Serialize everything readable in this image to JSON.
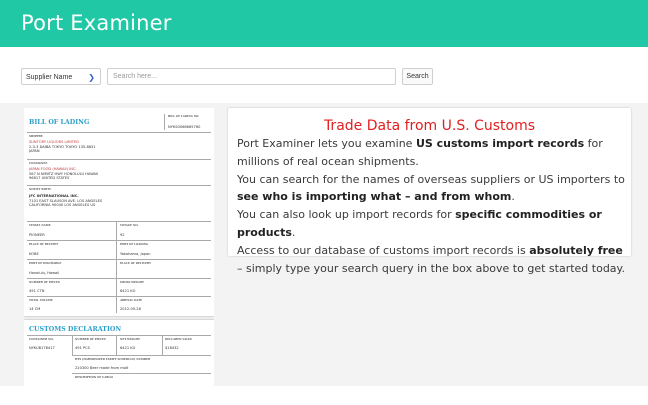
{
  "header": {
    "title": "Port Examiner"
  },
  "search": {
    "select_value": "Supplier Name",
    "placeholder": "Search here...",
    "button_label": "Search"
  },
  "document": {
    "bol_title": "BILL OF LADING",
    "bol_no_label": "BILL OF LADING NO.",
    "bol_no": "NYKS0066665760",
    "shipper_label": "SHIPPER",
    "shipper_name": "SUNTORY LIQUORS LIMITED",
    "shipper_addr1": "2-3-3 DAIBA TOKYO TOKYO 135-8631",
    "shipper_addr2": "JAPAN",
    "consignee_label": "CONSIGNEE",
    "consignee_name": "JAPAN FOOD (HAWAII) INC.",
    "consignee_addr1": "567 N NIMITZ HWY HONOLULU HAWAII",
    "consignee_addr2": "96817 UNITED STATES",
    "notify_label": "NOTIFY PARTY",
    "notify_name": "JFC INTERNATIONAL INC.",
    "notify_addr1": "7101 EAST SLAUSON AVE. LOS ANGELES",
    "notify_addr2": "CALIFORNIA 90040 LOS ANGELES US",
    "vessel_label": "VESSEL NAME",
    "vessel": "PIONEER",
    "voyage_label": "VOYAGE NO.",
    "voyage": "92",
    "receipt_label": "PLACE OF RECEIPT",
    "receipt": "KOBE",
    "loading_label": "PORT OF LOADING",
    "loading": "Yokohama, Japan",
    "discharge_label": "PORT OF DISCHARGE",
    "discharge": "Honolulu, Hawaii",
    "delivery_label": "PLACE OF DELIVERY",
    "delivery": "",
    "pieces_label": "NUMBER OF PIECES",
    "pieces": "491 CTN",
    "gross_label": "GROSS WEIGHT",
    "gross": "6421 KG",
    "volume_label": "TOTAL VOLUME",
    "volume": "14 CM",
    "arrival_label": "ARRIVAL DATE",
    "arrival": "2012-09-26",
    "customs_title": "CUSTOMS DECLARATION",
    "container_label": "CONTAINER NO.",
    "container": "NYKU8178417",
    "c_pieces_label": "NUMBER OF PIECES",
    "c_pieces": "491 PCS",
    "net_label": "NET WEIGHT",
    "net": "6421 KG",
    "declared_label": "DECLARED VALUE",
    "declared": "$18432",
    "hts_label": "HTS (HARMONIZED TARIFF SCHEDULE) NUMBER",
    "hts": "220300 Beer made from malt",
    "desc_label": "DESCRIPTION OF CARGO"
  },
  "info": {
    "title": "Trade Data from U.S. Customs",
    "p1_a": "Port Examiner lets you examine ",
    "p1_b": "US customs import records",
    "p1_c": " for millions of real ocean shipments.",
    "p2_a": "You can search for the names of overseas suppliers or US importers to ",
    "p2_b": "see who is importing what – and from whom",
    "p2_c": ".",
    "p3_a": "You can also look up import records for ",
    "p3_b": "specific commodities or products",
    "p3_c": ".",
    "p4_a": "Access to our database of customs import records is ",
    "p4_b": "absolutely free",
    "p4_c": " – simply type your search query in the box above to get started today."
  }
}
